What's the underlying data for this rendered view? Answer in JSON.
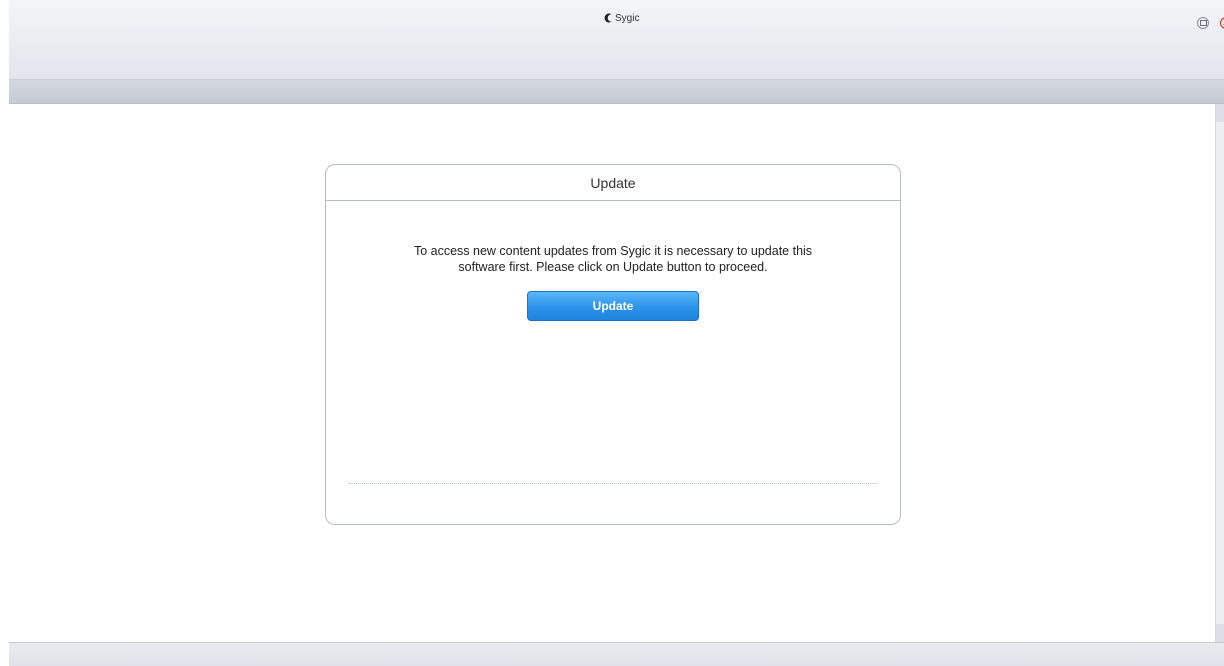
{
  "titlebar": {
    "logo_text": "Sygic",
    "restore_icon": "restore-icon",
    "close_icon": "close-icon",
    "close_glyph": "x"
  },
  "dialog": {
    "title": "Update",
    "message_line1": "To access new content updates from Sygic it is necessary to update this",
    "message_line2": "software first. Please click on Update button to proceed.",
    "button_label": "Update"
  },
  "colors": {
    "button_blue": "#2b93ea",
    "close_red": "#d0211a"
  }
}
